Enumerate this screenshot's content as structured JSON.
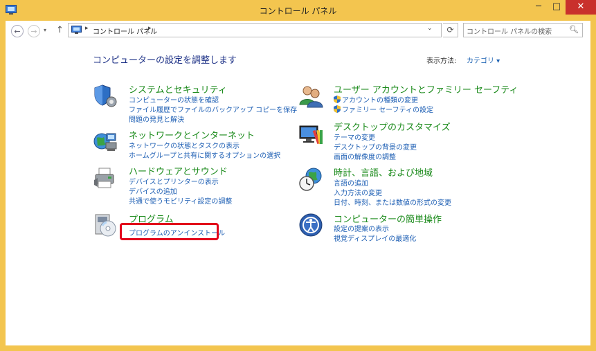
{
  "window": {
    "title": "コントロール パネル",
    "minimize": "─",
    "maximize": "□",
    "close": "✕"
  },
  "nav": {
    "back": "←",
    "forward": "→",
    "recent": "▾",
    "up": "↑",
    "breadcrumb": "コントロール パネル",
    "separator": "▸",
    "dropdown": "⌄",
    "refresh": "⟳"
  },
  "search": {
    "placeholder": "コントロール パネルの検索",
    "icon": "search-icon"
  },
  "header": {
    "title": "コンピューターの設定を調整します",
    "view_label": "表示方法:",
    "view_value": "カテゴリ ▾"
  },
  "categories": {
    "system": {
      "title": "システムとセキュリティ",
      "links": [
        "コンピューターの状態を確認",
        "ファイル履歴でファイルのバックアップ コピーを保存",
        "問題の発見と解決"
      ]
    },
    "network": {
      "title": "ネットワークとインターネット",
      "links": [
        "ネットワークの状態とタスクの表示",
        "ホームグループと共有に関するオプションの選択"
      ]
    },
    "hardware": {
      "title": "ハードウェアとサウンド",
      "links": [
        "デバイスとプリンターの表示",
        "デバイスの追加",
        "共通で使うモビリティ設定の調整"
      ]
    },
    "programs": {
      "title": "プログラム",
      "links": [
        "プログラムのアンインストール"
      ]
    },
    "user": {
      "title": "ユーザー アカウントとファミリー セーフティ",
      "links": [
        "アカウントの種類の変更",
        "ファミリー セーフティの設定"
      ]
    },
    "desktop": {
      "title": "デスクトップのカスタマイズ",
      "links": [
        "テーマの変更",
        "デスクトップの背景の変更",
        "画面の解像度の調整"
      ]
    },
    "clock": {
      "title": "時計、言語、および地域",
      "links": [
        "言語の追加",
        "入力方法の変更",
        "日付、時刻、または数値の形式の変更"
      ]
    },
    "ease": {
      "title": "コンピューターの簡単操作",
      "links": [
        "設定の提案の表示",
        "視覚ディスプレイの最適化"
      ]
    }
  },
  "colors": {
    "accent": "#f3c54f",
    "title_green": "#1a8a1a",
    "link_blue": "#1e5fb4",
    "highlight": "#e2001a",
    "close": "#c9302c"
  }
}
